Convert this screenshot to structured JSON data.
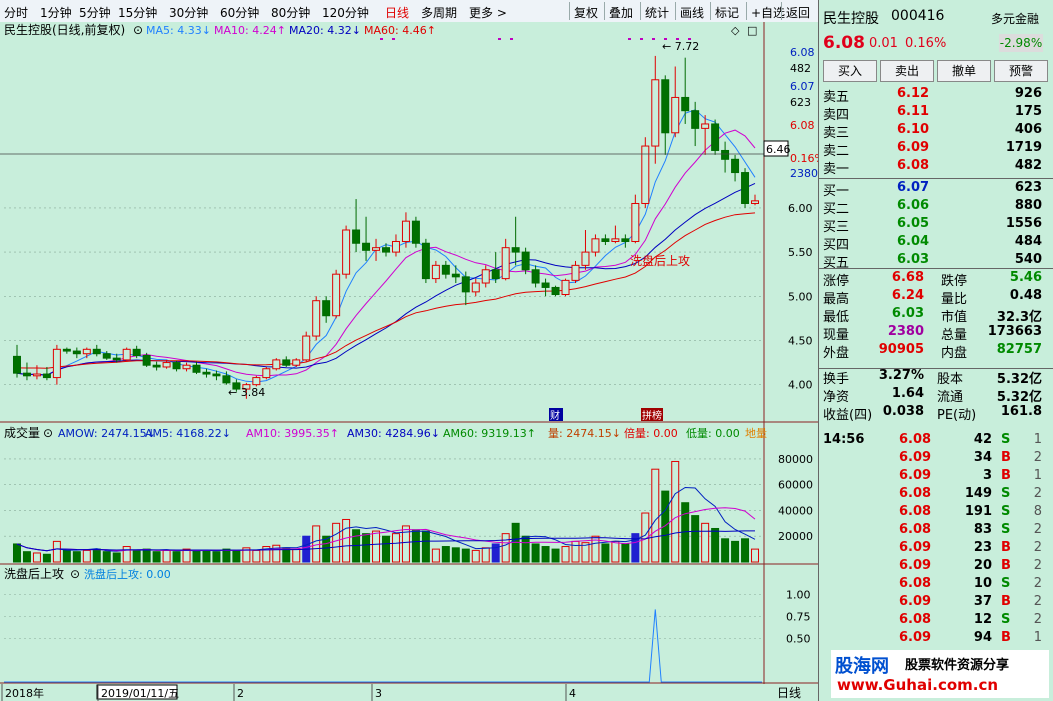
{
  "toolbar": {
    "periods": [
      "分时",
      "1分钟",
      "5分钟",
      "15分钟",
      "30分钟",
      "60分钟",
      "80分钟",
      "120分钟",
      "日线",
      "多周期",
      "更多 >"
    ],
    "active_period": "日线",
    "actions": [
      "复权",
      "叠加",
      "统计",
      "画线",
      "标记",
      "+自选",
      "返回"
    ]
  },
  "main_panel": {
    "title": "民生控股(日线,前复权)",
    "ma_legend": [
      {
        "label": "MA5: 4.33↓",
        "color": "#2080ff"
      },
      {
        "label": "MA10: 4.24↑",
        "color": "#d000d0"
      },
      {
        "label": "MA20: 4.32↓",
        "color": "#0000c0"
      },
      {
        "label": "MA60: 4.46↑",
        "color": "#e00000"
      }
    ],
    "annotation_high": "7.72",
    "annotation_low": "3.84",
    "indicator_label": "洗盘后上攻",
    "cross_price": "6.46",
    "markers": [
      "财",
      "拼榜"
    ]
  },
  "volume_panel": {
    "title": "成交量",
    "legend": [
      {
        "label": "AMOW: 2474.15↓",
        "color": "#0020c0"
      },
      {
        "label": "AM5: 4168.22↓",
        "color": "#0020c0"
      },
      {
        "label": "AM10: 3995.35↑",
        "color": "#d000d0"
      },
      {
        "label": "AM30: 4284.96↓",
        "color": "#0000c0"
      },
      {
        "label": "AM60: 9319.13↑",
        "color": "#008a00"
      },
      {
        "label": "量: 2474.15↓",
        "color": "#c04000"
      },
      {
        "label": "倍量: 0.00",
        "color": "#e00000"
      },
      {
        "label": "低量: 0.00",
        "color": "#008a00"
      },
      {
        "label": "地量",
        "color": "#e08000"
      }
    ]
  },
  "signal_panel": {
    "title": "洗盘后上攻",
    "legend": "洗盘后上攻: 0.00"
  },
  "date_axis": [
    "2018年",
    "2019/01/11/五",
    "2",
    "3",
    "4"
  ],
  "date_axis_right": "日线",
  "chart_data": [
    {
      "type": "candlestick",
      "ylim": [
        3.6,
        7.9
      ],
      "y_ticks": [
        4.0,
        4.5,
        5.0,
        5.5,
        6.0
      ],
      "right_labels": [
        "6.08",
        "482",
        "6.07",
        "623",
        "6.08",
        "0.16%",
        "2380"
      ],
      "candles": [
        {
          "o": 4.32,
          "h": 4.45,
          "l": 4.08,
          "c": 4.13
        },
        {
          "o": 4.13,
          "h": 4.25,
          "l": 4.05,
          "c": 4.1
        },
        {
          "o": 4.1,
          "h": 4.22,
          "l": 4.06,
          "c": 4.12
        },
        {
          "o": 4.12,
          "h": 4.2,
          "l": 4.05,
          "c": 4.08
        },
        {
          "o": 4.08,
          "h": 4.45,
          "l": 4.0,
          "c": 4.4
        },
        {
          "o": 4.4,
          "h": 4.42,
          "l": 4.35,
          "c": 4.38
        },
        {
          "o": 4.38,
          "h": 4.42,
          "l": 4.3,
          "c": 4.35
        },
        {
          "o": 4.35,
          "h": 4.42,
          "l": 4.3,
          "c": 4.4
        },
        {
          "o": 4.4,
          "h": 4.45,
          "l": 4.32,
          "c": 4.35
        },
        {
          "o": 4.35,
          "h": 4.38,
          "l": 4.28,
          "c": 4.3
        },
        {
          "o": 4.3,
          "h": 4.35,
          "l": 4.25,
          "c": 4.28
        },
        {
          "o": 4.28,
          "h": 4.42,
          "l": 4.26,
          "c": 4.4
        },
        {
          "o": 4.4,
          "h": 4.44,
          "l": 4.3,
          "c": 4.33
        },
        {
          "o": 4.33,
          "h": 4.36,
          "l": 4.2,
          "c": 4.22
        },
        {
          "o": 4.22,
          "h": 4.26,
          "l": 4.16,
          "c": 4.2
        },
        {
          "o": 4.2,
          "h": 4.28,
          "l": 4.18,
          "c": 4.25
        },
        {
          "o": 4.25,
          "h": 4.27,
          "l": 4.15,
          "c": 4.18
        },
        {
          "o": 4.18,
          "h": 4.25,
          "l": 4.15,
          "c": 4.22
        },
        {
          "o": 4.22,
          "h": 4.26,
          "l": 4.12,
          "c": 4.14
        },
        {
          "o": 4.14,
          "h": 4.18,
          "l": 4.08,
          "c": 4.12
        },
        {
          "o": 4.12,
          "h": 4.16,
          "l": 4.05,
          "c": 4.1
        },
        {
          "o": 4.1,
          "h": 4.15,
          "l": 4.0,
          "c": 4.02
        },
        {
          "o": 4.02,
          "h": 4.06,
          "l": 3.92,
          "c": 3.95
        },
        {
          "o": 3.95,
          "h": 4.02,
          "l": 3.84,
          "c": 4.0
        },
        {
          "o": 4.0,
          "h": 4.1,
          "l": 3.98,
          "c": 4.08
        },
        {
          "o": 4.08,
          "h": 4.2,
          "l": 4.06,
          "c": 4.18
        },
        {
          "o": 4.18,
          "h": 4.3,
          "l": 4.16,
          "c": 4.28
        },
        {
          "o": 4.28,
          "h": 4.32,
          "l": 4.2,
          "c": 4.22
        },
        {
          "o": 4.22,
          "h": 4.3,
          "l": 4.2,
          "c": 4.28
        },
        {
          "o": 4.28,
          "h": 4.6,
          "l": 4.26,
          "c": 4.55
        },
        {
          "o": 4.55,
          "h": 5.0,
          "l": 4.5,
          "c": 4.95
        },
        {
          "o": 4.95,
          "h": 5.0,
          "l": 4.7,
          "c": 4.78
        },
        {
          "o": 4.78,
          "h": 5.3,
          "l": 4.75,
          "c": 5.25
        },
        {
          "o": 5.25,
          "h": 5.8,
          "l": 5.2,
          "c": 5.75
        },
        {
          "o": 5.75,
          "h": 6.1,
          "l": 5.5,
          "c": 5.6
        },
        {
          "o": 5.6,
          "h": 5.9,
          "l": 5.4,
          "c": 5.52
        },
        {
          "o": 5.52,
          "h": 5.65,
          "l": 5.4,
          "c": 5.55
        },
        {
          "o": 5.55,
          "h": 5.6,
          "l": 5.45,
          "c": 5.5
        },
        {
          "o": 5.5,
          "h": 5.7,
          "l": 5.45,
          "c": 5.62
        },
        {
          "o": 5.62,
          "h": 5.95,
          "l": 5.55,
          "c": 5.85
        },
        {
          "o": 5.85,
          "h": 5.9,
          "l": 5.55,
          "c": 5.6
        },
        {
          "o": 5.6,
          "h": 5.65,
          "l": 5.15,
          "c": 5.2
        },
        {
          "o": 5.2,
          "h": 5.4,
          "l": 5.15,
          "c": 5.35
        },
        {
          "o": 5.35,
          "h": 5.4,
          "l": 5.2,
          "c": 5.25
        },
        {
          "o": 5.25,
          "h": 5.35,
          "l": 5.15,
          "c": 5.22
        },
        {
          "o": 5.22,
          "h": 5.28,
          "l": 4.9,
          "c": 5.05
        },
        {
          "o": 5.05,
          "h": 5.2,
          "l": 5.0,
          "c": 5.15
        },
        {
          "o": 5.15,
          "h": 5.35,
          "l": 5.1,
          "c": 5.3
        },
        {
          "o": 5.3,
          "h": 5.5,
          "l": 5.15,
          "c": 5.2
        },
        {
          "o": 5.2,
          "h": 5.65,
          "l": 5.18,
          "c": 5.55
        },
        {
          "o": 5.55,
          "h": 5.9,
          "l": 5.35,
          "c": 5.5
        },
        {
          "o": 5.5,
          "h": 5.55,
          "l": 5.25,
          "c": 5.3
        },
        {
          "o": 5.3,
          "h": 5.35,
          "l": 5.1,
          "c": 5.15
        },
        {
          "o": 5.15,
          "h": 5.2,
          "l": 5.0,
          "c": 5.1
        },
        {
          "o": 5.1,
          "h": 5.12,
          "l": 5.0,
          "c": 5.02
        },
        {
          "o": 5.02,
          "h": 5.2,
          "l": 5.0,
          "c": 5.18
        },
        {
          "o": 5.18,
          "h": 5.4,
          "l": 5.15,
          "c": 5.35
        },
        {
          "o": 5.35,
          "h": 5.75,
          "l": 5.3,
          "c": 5.5
        },
        {
          "o": 5.5,
          "h": 5.7,
          "l": 5.45,
          "c": 5.65
        },
        {
          "o": 5.65,
          "h": 5.7,
          "l": 5.58,
          "c": 5.62
        },
        {
          "o": 5.62,
          "h": 5.8,
          "l": 5.6,
          "c": 5.65
        },
        {
          "o": 5.65,
          "h": 5.7,
          "l": 5.55,
          "c": 5.62
        },
        {
          "o": 5.62,
          "h": 6.15,
          "l": 5.6,
          "c": 6.05
        },
        {
          "o": 6.05,
          "h": 6.8,
          "l": 6.0,
          "c": 6.7
        },
        {
          "o": 6.7,
          "h": 7.72,
          "l": 6.5,
          "c": 7.45
        },
        {
          "o": 7.45,
          "h": 7.5,
          "l": 6.6,
          "c": 6.85
        },
        {
          "o": 6.85,
          "h": 7.6,
          "l": 6.8,
          "c": 7.25
        },
        {
          "o": 7.25,
          "h": 7.7,
          "l": 6.95,
          "c": 7.1
        },
        {
          "o": 7.1,
          "h": 7.2,
          "l": 6.7,
          "c": 6.9
        },
        {
          "o": 6.9,
          "h": 7.05,
          "l": 6.6,
          "c": 6.95
        },
        {
          "o": 6.95,
          "h": 7.0,
          "l": 6.6,
          "c": 6.65
        },
        {
          "o": 6.65,
          "h": 6.75,
          "l": 6.4,
          "c": 6.55
        },
        {
          "o": 6.55,
          "h": 6.6,
          "l": 6.3,
          "c": 6.4
        },
        {
          "o": 6.4,
          "h": 6.45,
          "l": 6.0,
          "c": 6.05
        },
        {
          "o": 6.05,
          "h": 6.15,
          "l": 6.03,
          "c": 6.08
        }
      ],
      "volume": [
        14,
        8,
        7,
        6,
        16,
        9,
        8,
        9,
        10,
        8,
        7,
        12,
        9,
        10,
        8,
        9,
        8,
        10,
        9,
        9,
        8,
        10,
        9,
        11,
        9,
        12,
        13,
        11,
        10,
        20,
        28,
        20,
        30,
        33,
        25,
        22,
        24,
        20,
        22,
        28,
        25,
        24,
        10,
        12,
        11,
        10,
        9,
        11,
        14,
        22,
        30,
        20,
        14,
        12,
        10,
        12,
        16,
        15,
        20,
        14,
        16,
        14,
        22,
        38,
        72,
        55,
        78,
        46,
        36,
        30,
        26,
        18,
        16,
        18,
        10
      ],
      "volume_ylim": [
        0,
        90000
      ],
      "volume_ticks": [
        20000,
        40000,
        60000,
        80000
      ]
    },
    {
      "type": "line",
      "title": "洗盘后上攻",
      "ylim": [
        0,
        1.2
      ],
      "y_ticks": [
        0.5,
        0.75,
        1.0
      ],
      "spike_index": 64
    }
  ],
  "quote": {
    "name": "民生控股",
    "code": "000416",
    "badge": "多元金融",
    "price": "6.08",
    "change": "0.01",
    "pct": "0.16%",
    "side_pct": "-2.98%",
    "buttons": [
      "买入",
      "卖出",
      "撤单",
      "预警"
    ],
    "asks": [
      {
        "label": "卖五",
        "price": "6.12",
        "vol": "926"
      },
      {
        "label": "卖四",
        "price": "6.11",
        "vol": "175"
      },
      {
        "label": "卖三",
        "price": "6.10",
        "vol": "406"
      },
      {
        "label": "卖二",
        "price": "6.09",
        "vol": "1719"
      },
      {
        "label": "卖一",
        "price": "6.08",
        "vol": "482"
      }
    ],
    "bids": [
      {
        "label": "买一",
        "price": "6.07",
        "vol": "623"
      },
      {
        "label": "买二",
        "price": "6.06",
        "vol": "880"
      },
      {
        "label": "买三",
        "price": "6.05",
        "vol": "1556"
      },
      {
        "label": "买四",
        "price": "6.04",
        "vol": "484"
      },
      {
        "label": "买五",
        "price": "6.03",
        "vol": "540"
      }
    ],
    "stats": [
      {
        "k1": "涨停",
        "v1": "6.68",
        "c1": "red",
        "k2": "跌停",
        "v2": "5.46",
        "c2": "grn"
      },
      {
        "k1": "最高",
        "v1": "6.24",
        "c1": "red",
        "k2": "量比",
        "v2": "0.48",
        "c2": "blk"
      },
      {
        "k1": "最低",
        "v1": "6.03",
        "c1": "grn",
        "k2": "市值",
        "v2": "32.3亿",
        "c2": "blk"
      },
      {
        "k1": "现量",
        "v1": "2380",
        "c1": "pur",
        "k2": "总量",
        "v2": "173663",
        "c2": "blk"
      },
      {
        "k1": "外盘",
        "v1": "90905",
        "c1": "red",
        "k2": "内盘",
        "v2": "82757",
        "c2": "grn"
      }
    ],
    "fund": [
      {
        "k1": "换手",
        "v1": "3.27%",
        "k2": "股本",
        "v2": "5.32亿"
      },
      {
        "k1": "净资",
        "v1": "1.64",
        "k2": "流通",
        "v2": "5.32亿"
      },
      {
        "k1": "收益(四)",
        "v1": "0.038",
        "k2": "PE(动)",
        "v2": "161.8"
      }
    ],
    "ticks_time": "14:56",
    "ticks": [
      {
        "p": "6.08",
        "v": "42",
        "s": "S",
        "n": "1"
      },
      {
        "p": "6.09",
        "v": "34",
        "s": "B",
        "n": "2"
      },
      {
        "p": "6.09",
        "v": "3",
        "s": "B",
        "n": "1"
      },
      {
        "p": "6.08",
        "v": "149",
        "s": "S",
        "n": "2"
      },
      {
        "p": "6.08",
        "v": "191",
        "s": "S",
        "n": "8"
      },
      {
        "p": "6.08",
        "v": "83",
        "s": "S",
        "n": "2"
      },
      {
        "p": "6.09",
        "v": "23",
        "s": "B",
        "n": "2"
      },
      {
        "p": "6.09",
        "v": "20",
        "s": "B",
        "n": "2"
      },
      {
        "p": "6.08",
        "v": "10",
        "s": "S",
        "n": "2"
      },
      {
        "p": "6.09",
        "v": "37",
        "s": "B",
        "n": "2"
      },
      {
        "p": "6.08",
        "v": "12",
        "s": "S",
        "n": "2"
      },
      {
        "p": "6.09",
        "v": "94",
        "s": "B",
        "n": "1"
      }
    ],
    "watermark": "股海网",
    "watermark_sub": "股票软件资源分享",
    "watermark_url": "www.Guhai.com.cn"
  }
}
